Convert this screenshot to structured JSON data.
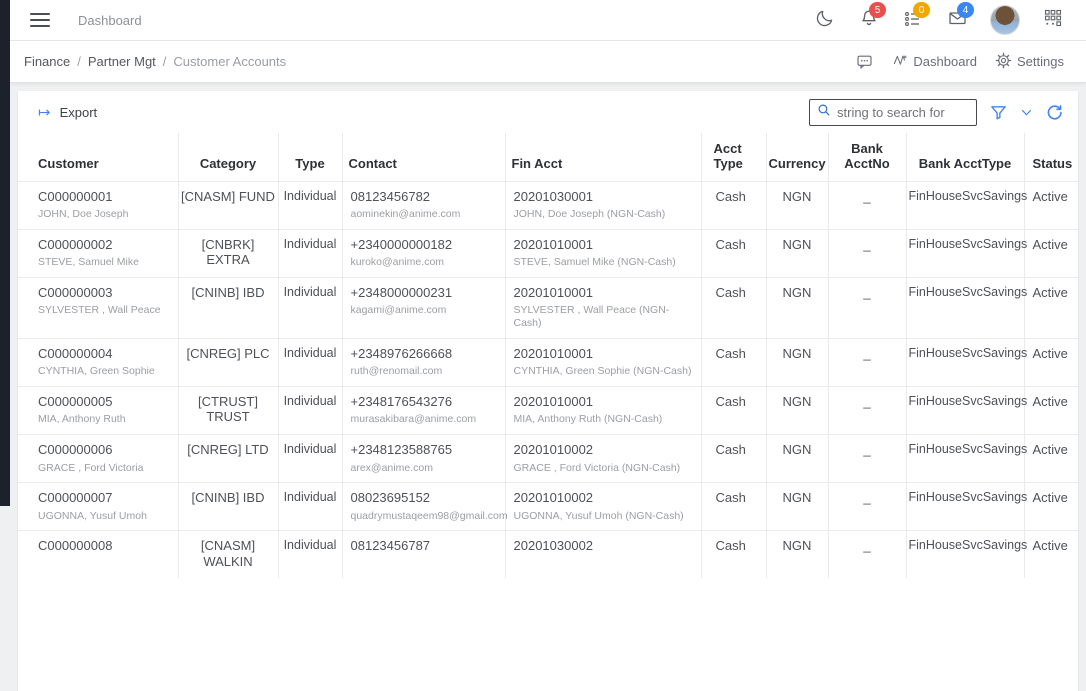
{
  "topbar": {
    "title": "Dashboard",
    "badges": {
      "notifications": "5",
      "tasks": "0",
      "messages": "4"
    }
  },
  "breadcrumb": {
    "items": [
      "Finance",
      "Partner Mgt",
      "Customer Accounts"
    ],
    "separator": "/",
    "actions": {
      "dashboard": "Dashboard",
      "settings": "Settings"
    }
  },
  "toolbar": {
    "export_label": "Export",
    "search_placeholder": "string to search for",
    "search_value": ""
  },
  "colors": {
    "accent_blue": "#4285f4",
    "badge_red": "#e8504f",
    "badge_yellow": "#f0a800",
    "badge_blue": "#3b86f0",
    "sidebar_dark": "#1d212b"
  },
  "table": {
    "columns": [
      "Customer",
      "Category",
      "Type",
      "Contact",
      "Fin Acct",
      "Acct Type",
      "Currency",
      "Bank AcctNo",
      "Bank AcctType",
      "Status"
    ],
    "rows": [
      {
        "id": "C000000001",
        "name": "JOHN, Doe Joseph",
        "category": "[CNASM] FUND",
        "type": "Individual",
        "phone": "08123456782",
        "email": "aominekin@anime.com",
        "acct": "20201030001",
        "acct_name": "JOHN, Doe Joseph (NGN-Cash)",
        "acct_type": "Cash",
        "currency": "NGN",
        "bank_no": "_",
        "bank_type": "FinHouseSvcSavings",
        "status": "Active"
      },
      {
        "id": "C000000002",
        "name": "STEVE, Samuel Mike",
        "category": "[CNBRK] EXTRA",
        "type": "Individual",
        "phone": "+2340000000182",
        "email": "kuroko@anime.com",
        "acct": "20201010001",
        "acct_name": "STEVE, Samuel Mike (NGN-Cash)",
        "acct_type": "Cash",
        "currency": "NGN",
        "bank_no": "_",
        "bank_type": "FinHouseSvcSavings",
        "status": "Active"
      },
      {
        "id": "C000000003",
        "name": "SYLVESTER , Wall Peace",
        "category": "[CNINB] IBD",
        "type": "Individual",
        "phone": "+2348000000231",
        "email": "kagami@anime.com",
        "acct": "20201010001",
        "acct_name": "SYLVESTER , Wall Peace (NGN-Cash)",
        "acct_type": "Cash",
        "currency": "NGN",
        "bank_no": "_",
        "bank_type": "FinHouseSvcSavings",
        "status": "Active"
      },
      {
        "id": "C000000004",
        "name": "CYNTHIA, Green Sophie",
        "category": "[CNREG] PLC",
        "type": "Individual",
        "phone": "+2348976266668",
        "email": "ruth@renomail.com",
        "acct": "20201010001",
        "acct_name": "CYNTHIA, Green Sophie (NGN-Cash)",
        "acct_type": "Cash",
        "currency": "NGN",
        "bank_no": "_",
        "bank_type": "FinHouseSvcSavings",
        "status": "Active"
      },
      {
        "id": "C000000005",
        "name": "MIA, Anthony Ruth",
        "category": "[CTRUST] TRUST",
        "type": "Individual",
        "phone": "+2348176543276",
        "email": "murasakibara@anime.com",
        "acct": "20201010001",
        "acct_name": "MIA, Anthony Ruth (NGN-Cash)",
        "acct_type": "Cash",
        "currency": "NGN",
        "bank_no": "_",
        "bank_type": "FinHouseSvcSavings",
        "status": "Active"
      },
      {
        "id": "C000000006",
        "name": "GRACE , Ford Victoria",
        "category": "[CNREG] LTD",
        "type": "Individual",
        "phone": "+2348123588765",
        "email": "arex@anime.com",
        "acct": "20201010002",
        "acct_name": "GRACE , Ford Victoria (NGN-Cash)",
        "acct_type": "Cash",
        "currency": "NGN",
        "bank_no": "_",
        "bank_type": "FinHouseSvcSavings",
        "status": "Active"
      },
      {
        "id": "C000000007",
        "name": "UGONNA, Yusuf Umoh",
        "category": "[CNINB] IBD",
        "type": "Individual",
        "phone": "08023695152",
        "email": "quadrymustaqeem98@gmail.com",
        "acct": "20201010002",
        "acct_name": "UGONNA, Yusuf Umoh (NGN-Cash)",
        "acct_type": "Cash",
        "currency": "NGN",
        "bank_no": "_",
        "bank_type": "FinHouseSvcSavings",
        "status": "Active"
      },
      {
        "id": "C000000008",
        "name": "",
        "category": "[CNASM] WALKIN",
        "type": "Individual",
        "phone": "08123456787",
        "email": "",
        "acct": "20201030002",
        "acct_name": "",
        "acct_type": "Cash",
        "currency": "NGN",
        "bank_no": "_",
        "bank_type": "FinHouseSvcSavings",
        "status": "Active"
      }
    ]
  }
}
